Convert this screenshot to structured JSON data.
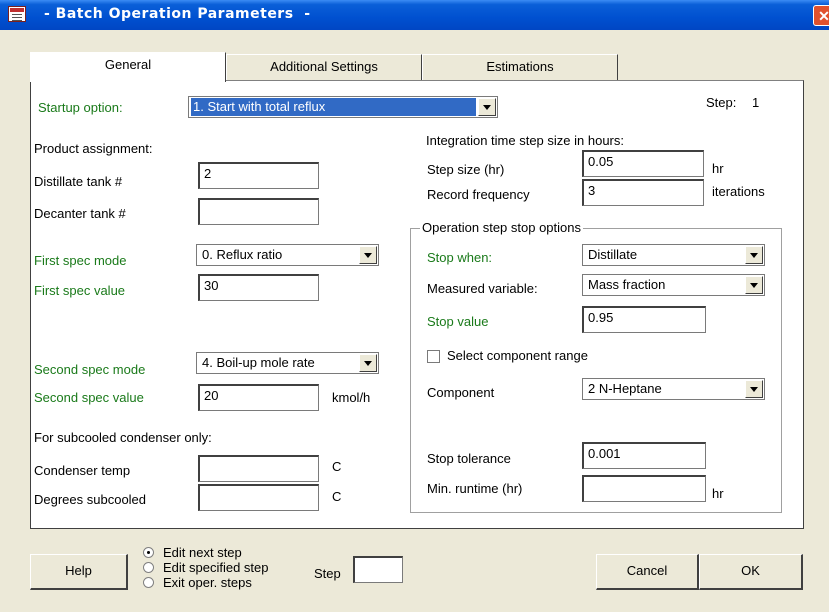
{
  "window": {
    "title": "- Batch Operation Parameters  -",
    "close_symbol": "✕"
  },
  "tabs": [
    {
      "label": "General",
      "active": true
    },
    {
      "label": "Additional Settings",
      "active": false
    },
    {
      "label": "Estimations",
      "active": false
    }
  ],
  "startup": {
    "label": "Startup option:",
    "value": "1. Start with total reflux"
  },
  "step": {
    "label": "Step:",
    "value": "1"
  },
  "product": {
    "heading": "Product assignment:",
    "distillate_label": "Distillate tank #",
    "distillate_value": "2",
    "decanter_label": "Decanter tank #",
    "decanter_value": ""
  },
  "first_spec": {
    "mode_label": "First spec mode",
    "mode_value": "0.  Reflux ratio",
    "value_label": "First spec value",
    "value": "30"
  },
  "second_spec": {
    "mode_label": "Second spec mode",
    "mode_value": "4.  Boil-up mole rate",
    "value_label": "Second spec value",
    "value": "20",
    "unit": "kmol/h"
  },
  "condenser": {
    "heading": "For subcooled condenser only:",
    "temp_label": "Condenser temp",
    "temp_value": "",
    "temp_unit": "C",
    "subcool_label": "Degrees subcooled",
    "subcool_value": "",
    "subcool_unit": "C"
  },
  "integration": {
    "heading": "Integration time step size in hours:",
    "step_label": "Step size (hr)",
    "step_value": "0.05",
    "step_unit": "hr",
    "record_label": "Record frequency",
    "record_value": "3",
    "record_unit": "iterations"
  },
  "stop_options": {
    "title": "Operation step stop options",
    "stop_when_label": "Stop when:",
    "stop_when_value": "Distillate",
    "measured_label": "Measured variable:",
    "measured_value": "Mass fraction",
    "stop_value_label": "Stop value",
    "stop_value": "0.95",
    "component_range_label": "Select component range",
    "component_range_checked": false,
    "component_label": "Component",
    "component_value": "2 N-Heptane",
    "tolerance_label": "Stop tolerance",
    "tolerance_value": "0.001",
    "runtime_label": "Min. runtime (hr)",
    "runtime_value": "",
    "runtime_unit": "hr"
  },
  "footer": {
    "help": "Help",
    "radios": [
      {
        "label": "Edit next step",
        "selected": true
      },
      {
        "label": "Edit specified step",
        "selected": false
      },
      {
        "label": "Exit oper. steps",
        "selected": false
      }
    ],
    "step_label": "Step",
    "step_value": "",
    "cancel": "Cancel",
    "ok": "OK"
  },
  "colors": {
    "title_bar": "#0050d0",
    "green_label": "#1a7a1a",
    "selection": "#316ac5"
  }
}
